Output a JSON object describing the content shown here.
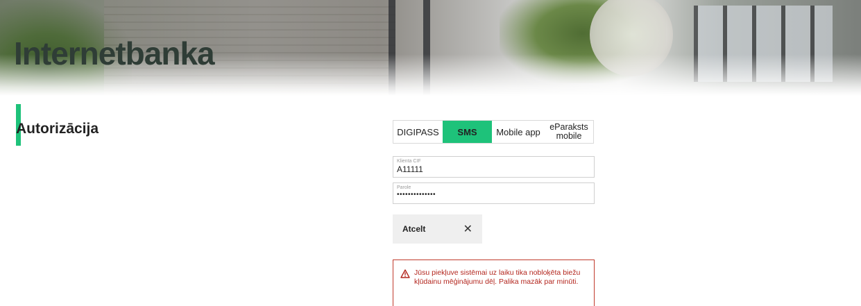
{
  "hero": {
    "title": "Internetbanka"
  },
  "section": {
    "title": "Autorizācija"
  },
  "auth_tabs": [
    {
      "label": "DIGIPASS",
      "active": false
    },
    {
      "label": "SMS",
      "active": true
    },
    {
      "label": "Mobile app",
      "active": false
    },
    {
      "label": "eParaksts mobile",
      "active": false
    }
  ],
  "form": {
    "client_cif": {
      "label": "Klienta CIF",
      "value": "A11111"
    },
    "password": {
      "label": "Parole",
      "value": "••••••••••••••"
    }
  },
  "cancel_button": {
    "label": "Atcelt",
    "icon": "close-icon"
  },
  "alert": {
    "icon": "warning-icon",
    "message": "Jūsu piekļuve sistēmai uz laiku tika nobloķēta biežu kļūdainu mēģinājumu dēļ. Palika mazāk par minūti."
  },
  "colors": {
    "accent": "#1ec27a",
    "error": "#b3261e",
    "hero_title": "#2f3d36"
  }
}
